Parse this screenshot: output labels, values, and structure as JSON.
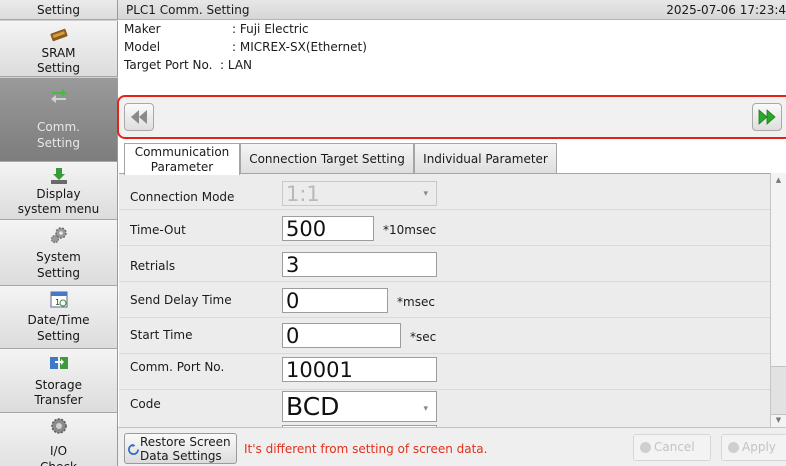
{
  "sidebar": {
    "items": [
      {
        "label": "E-Mail Setting",
        "icon": "mail-icon"
      },
      {
        "label": "SRAM Setting",
        "icon": "memory-chip-icon"
      },
      {
        "label": "Comm. Setting",
        "icon": "communication-arrows-icon",
        "active": true
      },
      {
        "label": "Display system menu",
        "icon": "download-arrow-icon"
      },
      {
        "label": "System Setting",
        "icon": "gears-icon"
      },
      {
        "label": "Date/Time Setting",
        "icon": "calendar-icon"
      },
      {
        "label": "Storage Transfer",
        "icon": "transfer-arrows-icon"
      },
      {
        "label": "I/O Check",
        "icon": "io-gear-icon"
      }
    ]
  },
  "header": {
    "title": "PLC1 Comm. Setting",
    "datetime": "2025-07-06 17:23:4"
  },
  "info": {
    "maker_label": "Maker",
    "maker_value": ": Fuji Electric",
    "model_label": "Model",
    "model_value": ": MICREX-SX(Ethernet)",
    "port_label": "Target Port No.",
    "port_value": ": LAN"
  },
  "nav": {
    "prev_icon": "double-left-arrow-icon",
    "next_icon": "double-right-arrow-icon"
  },
  "tabs": {
    "comm_line1": "Communication",
    "comm_line2": "Parameter",
    "target": "Connection Target Setting",
    "individual": "Individual Parameter",
    "active": "comm"
  },
  "params": {
    "connection_mode_label": "Connection Mode",
    "connection_mode_value": "1:1",
    "timeout_label": "Time-Out",
    "timeout_value": "500",
    "timeout_unit": "*10msec",
    "retrials_label": "Retrials",
    "retrials_value": "3",
    "send_delay_label": "Send Delay Time",
    "send_delay_value": "0",
    "send_delay_unit": "*msec",
    "start_time_label": "Start Time",
    "start_time_value": "0",
    "start_time_unit": "*sec",
    "comm_port_label": "Comm. Port No.",
    "comm_port_value": "10001",
    "code_label": "Code",
    "code_value": "BCD"
  },
  "footer": {
    "restore_line1": "Restore Screen",
    "restore_line2": "Data Settings",
    "message": "It's different from setting of screen data.",
    "cancel": "Cancel",
    "apply": "Apply"
  },
  "colors": {
    "highlight_border": "#e2231a",
    "message_red": "#e0321e",
    "next_arrow_green": "#2aa82a",
    "sidebar_active": "#8a8a8a"
  }
}
